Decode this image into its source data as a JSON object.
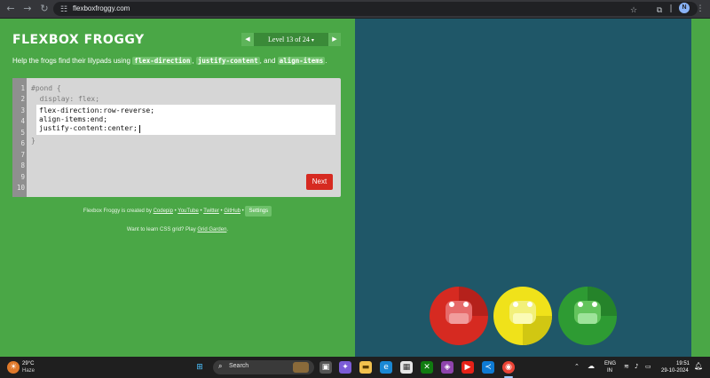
{
  "browser": {
    "url": "flexboxfroggy.com",
    "avatar_letter": "N"
  },
  "game": {
    "logo": "FLEXBOX FROGGY",
    "level_label": "Level 13 of 24",
    "level_caret": "▾",
    "instructions": {
      "prefix": "Help the frogs find their lilypads using",
      "tag1": "flex-direction",
      "sep1": ",",
      "tag2": "justify-content",
      "sep2": ", and",
      "tag3": "align-items",
      "suffix": "."
    },
    "line_numbers": [
      "1",
      "2",
      "3",
      "4",
      "5",
      "6",
      "7",
      "8",
      "9",
      "10"
    ],
    "code_header": "#pond {",
    "code_display": "  display: flex;",
    "code_input_lines": [
      "flex-direction:row-reverse;",
      "align-items:end;",
      "justify-content:center;"
    ],
    "code_close": "}",
    "next_label": "Next",
    "footer": {
      "prefix": "Flexbox Froggy is created by",
      "link1": "Codepip",
      "dot": "•",
      "link2": "YouTube",
      "link3": "Twitter",
      "link4": "GitHub",
      "settings": "Settings"
    },
    "footer2": {
      "prefix": "Want to learn CSS grid? Play",
      "link": "Grid Garden",
      "suffix": "."
    },
    "frogs": [
      {
        "color": "red",
        "pad": "#d62a21",
        "frog": "#e66a6a"
      },
      {
        "color": "yellow",
        "pad": "#f0e21a",
        "frog": "#f2f07a"
      },
      {
        "color": "green",
        "pad": "#2e9b33",
        "frog": "#63c45c"
      }
    ]
  },
  "taskbar": {
    "weather_temp": "29°C",
    "weather_desc": "Haze",
    "search_placeholder": "Search",
    "lang_top": "ENG",
    "lang_bottom": "IN",
    "time": "19:51",
    "date": "29-10-2024"
  }
}
